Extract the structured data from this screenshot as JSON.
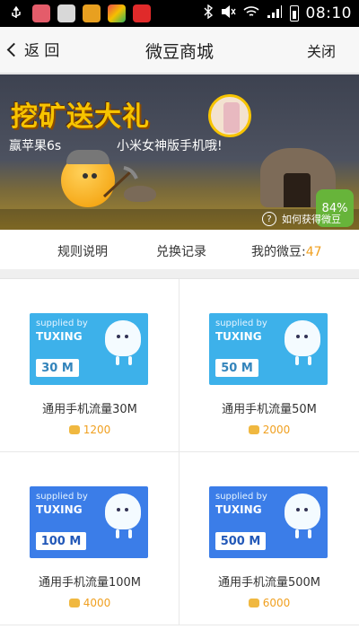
{
  "status_bar": {
    "time": "08:10",
    "icons": [
      "usb-icon",
      "app-icon-1",
      "app-icon-2",
      "app-icon-3",
      "app-icon-4",
      "app-icon-5",
      "bluetooth-icon",
      "mute-icon",
      "wifi-icon",
      "signal-icon",
      "battery-icon"
    ]
  },
  "nav": {
    "back_label": "返 回",
    "title": "微豆商城",
    "close_label": "关闭"
  },
  "banner": {
    "headline": "挖矿送大礼",
    "sub_left": "赢苹果6s",
    "sub_right": "小米女神版手机哦!",
    "percent_badge": "84%",
    "help_text": "如何获得微豆"
  },
  "tabs": {
    "rules": "规则说明",
    "history": "兑换记录",
    "balance_label": "我的微豆:",
    "balance_value": "47"
  },
  "products": [
    {
      "supplied": "supplied by",
      "brand": "TUXING",
      "amount": "30 M",
      "name": "通用手机流量30M",
      "price": "1200"
    },
    {
      "supplied": "supplied by",
      "brand": "TUXING",
      "amount": "50 M",
      "name": "通用手机流量50M",
      "price": "2000"
    },
    {
      "supplied": "supplied by",
      "brand": "TUXING",
      "amount": "100 M",
      "name": "通用手机流量100M",
      "price": "4000"
    },
    {
      "supplied": "supplied by",
      "brand": "TUXING",
      "amount": "500 M",
      "name": "通用手机流量500M",
      "price": "6000"
    }
  ],
  "colors": {
    "accent_orange": "#f0a020",
    "card_light": "#3db1ea",
    "card_dark": "#3b7de8"
  }
}
